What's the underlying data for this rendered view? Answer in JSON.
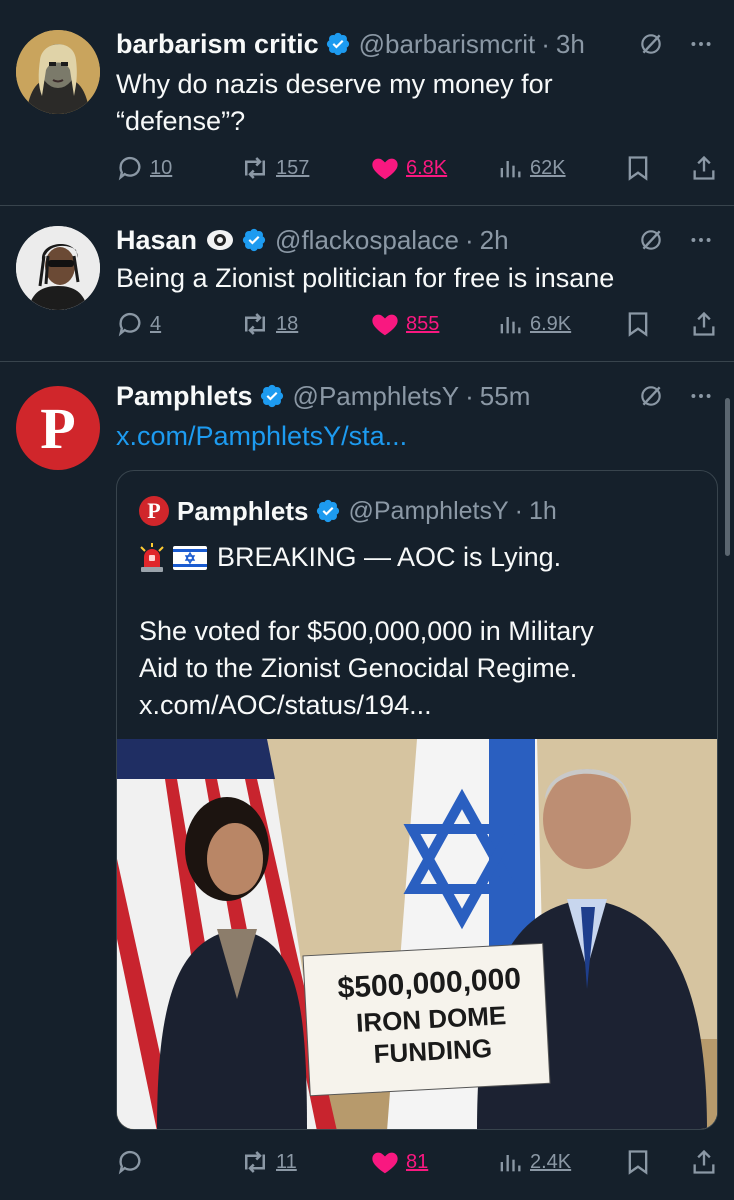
{
  "tweets": [
    {
      "name": "barbarism critic",
      "handle": "@barbarismcrit",
      "separator": "·",
      "time": "3h",
      "text_lines": [
        "Why do nazis deserve my money for",
        "“defense”?"
      ],
      "replies": "10",
      "reposts": "157",
      "likes": "6.8K",
      "views": "62K",
      "liked": true
    },
    {
      "name": "Hasan",
      "handle": "@flackospalace",
      "separator": "·",
      "time": "2h",
      "text_lines": [
        "Being a Zionist politician for free is insane"
      ],
      "replies": "4",
      "reposts": "18",
      "likes": "855",
      "views": "6.9K",
      "liked": true
    },
    {
      "name": "Pamphlets",
      "handle": "@PamphletsY",
      "separator": "·",
      "time": "55m",
      "link": "x.com/PamphletsY/sta...",
      "replies": "",
      "reposts": "11",
      "likes": "81",
      "views": "2.4K",
      "liked": true,
      "avatar_letter": "P"
    }
  ],
  "quote": {
    "name": "Pamphlets",
    "handle": "@PamphletsY",
    "separator": "·",
    "time": "1h",
    "avatar_letter": "P",
    "line1_emojis": [
      "🚨",
      "🇮🇱"
    ],
    "line1_text": "BREAKING —  AOC is Lying.",
    "body_lines": [
      "She voted for $500,000,000 in Military",
      "Aid to the Zionist Genocidal Regime."
    ],
    "link": "x.com/AOC/status/194...",
    "media_sign": [
      "$500,000,000",
      "IRON DOME",
      "FUNDING"
    ]
  },
  "colors": {
    "background": "#15202b",
    "text": "#f7f9f9",
    "secondary": "#8b98a5",
    "link": "#1d9bf0",
    "like": "#f91880",
    "verified": "#1d9bf0",
    "divider": "#38444d"
  },
  "icons": {
    "verified": "verified-badge-icon",
    "grok": "grok-icon",
    "more": "more-icon",
    "reply": "reply-icon",
    "repost": "repost-icon",
    "like": "heart-icon",
    "views": "views-icon",
    "bookmark": "bookmark-icon",
    "share": "share-icon"
  }
}
